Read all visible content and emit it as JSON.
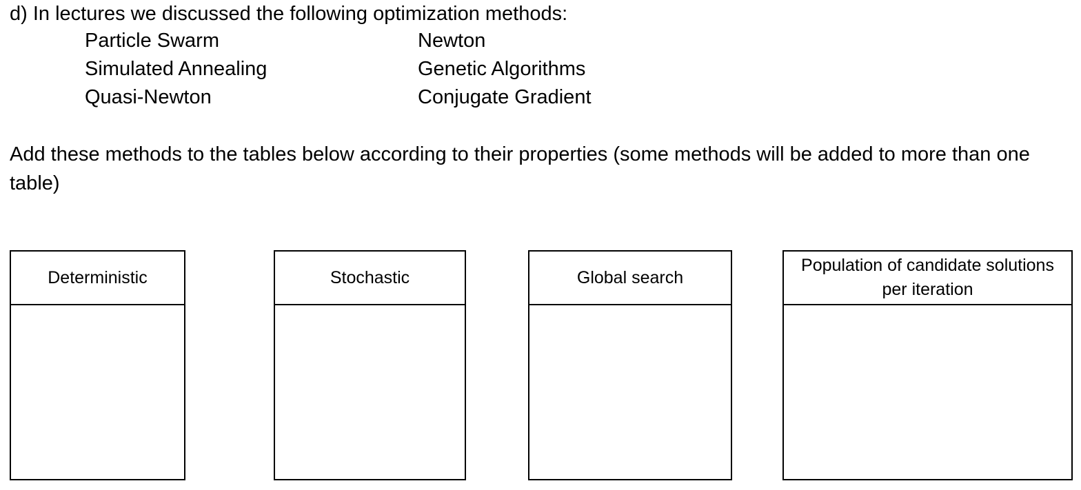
{
  "question": {
    "text": "d) In lectures we discussed the following optimization methods:"
  },
  "methods": {
    "left": [
      "Particle Swarm",
      "Simulated Annealing",
      "Quasi-Newton"
    ],
    "right": [
      "Newton",
      "Genetic Algorithms",
      "Conjugate Gradient"
    ]
  },
  "instruction": {
    "text": "Add these methods to the tables below according to their properties (some methods will be added to more than one table)"
  },
  "tables": [
    {
      "header": "Deterministic"
    },
    {
      "header": "Stochastic"
    },
    {
      "header": "Global search"
    },
    {
      "header": "Population of candidate solutions per iteration"
    }
  ]
}
